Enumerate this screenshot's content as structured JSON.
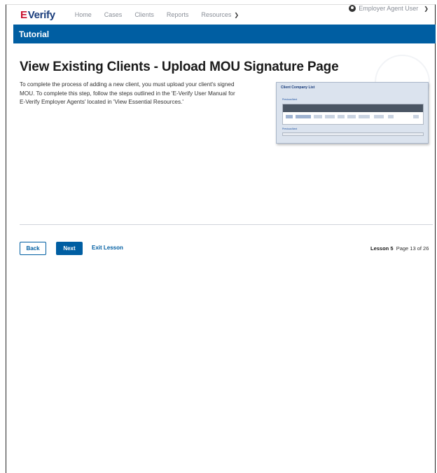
{
  "header": {
    "logo_mark": "E",
    "logo_text": "Verify",
    "nav": [
      "Home",
      "Cases",
      "Clients",
      "Reports",
      "Resources"
    ],
    "user_label": "Employer Agent User"
  },
  "banner": {
    "title": "Tutorial"
  },
  "main": {
    "page_title": "View Existing Clients - Upload MOU Signature Page",
    "body_line_1": "To complete the process of adding a new client, you must upload your client's signed",
    "body_line_2": "MOU. To complete this step, follow the steps outlined in the 'E-Verify User Manual for",
    "body_line_3": "E-Verify Employer Agents' located in 'View Essential Resources.'",
    "thumbnail": {
      "title": "Client Company List",
      "link_previous": "Previous",
      "link_next": "Next"
    }
  },
  "footer": {
    "back_label": "Back",
    "next_label": "Next",
    "exit_label": "Exit Lesson",
    "lesson_label": "Lesson 5",
    "page_label": "Page 13 of 26"
  },
  "colors": {
    "brand_blue": "#005ea2",
    "logo_red": "#c8102e",
    "logo_navy": "#1a3d7c"
  }
}
